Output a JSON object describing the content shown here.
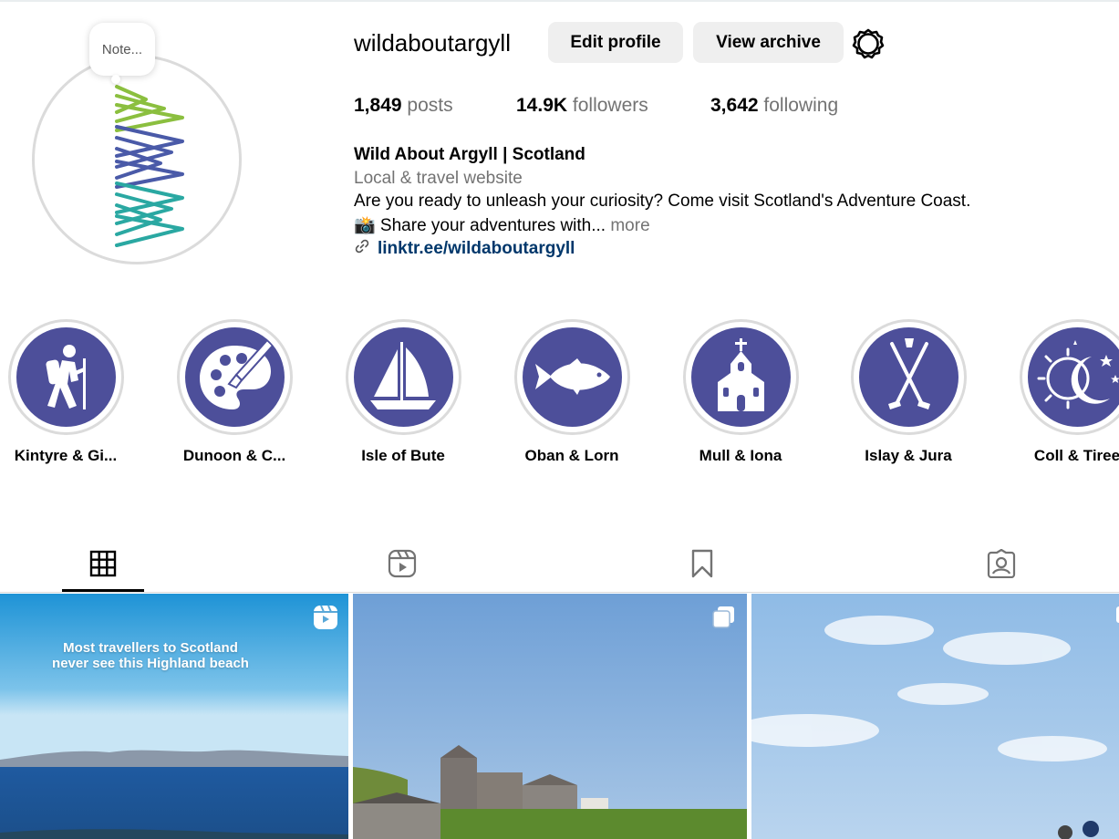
{
  "profile": {
    "username": "wildaboutargyll",
    "note_placeholder": "Note...",
    "edit_label": "Edit profile",
    "archive_label": "View archive",
    "settings_icon": "gear-icon"
  },
  "stats": [
    {
      "value": "1,849",
      "label": "posts"
    },
    {
      "value": "14.9K",
      "label": "followers"
    },
    {
      "value": "3,642",
      "label": "following"
    }
  ],
  "bio": {
    "name": "Wild About Argyll | Scotland",
    "category": "Local & travel website",
    "line1": "Are you ready to unleash your curiosity? Come visit Scotland's Adventure Coast.",
    "line2": "📸 Share your adventures with... ",
    "more": "more",
    "link": "linktr.ee/wildaboutargyll"
  },
  "highlights": [
    {
      "label": "Kintyre & Gi...",
      "icon": "hiker-icon"
    },
    {
      "label": "Dunoon & C...",
      "icon": "paint-palette-icon"
    },
    {
      "label": "Isle of Bute",
      "icon": "sailboat-icon"
    },
    {
      "label": "Oban & Lorn",
      "icon": "fish-icon"
    },
    {
      "label": "Mull & Iona",
      "icon": "church-icon"
    },
    {
      "label": "Islay & Jura",
      "icon": "golf-clubs-icon"
    },
    {
      "label": "Coll & Tiree",
      "icon": "moon-stars-icon"
    }
  ],
  "tabs": [
    "grid-icon",
    "reels-icon",
    "saved-icon",
    "tagged-icon"
  ],
  "posts": [
    {
      "caption_line1": "Most travellers to Scotland",
      "caption_line2": "never see this Highland beach",
      "badge": "reel-icon"
    },
    {
      "badge": "carousel-icon"
    },
    {
      "badge": "carousel-icon"
    }
  ],
  "colors": {
    "highlight_bg": "#4d4f9a",
    "link": "#00376b",
    "button_bg": "#efefef"
  }
}
